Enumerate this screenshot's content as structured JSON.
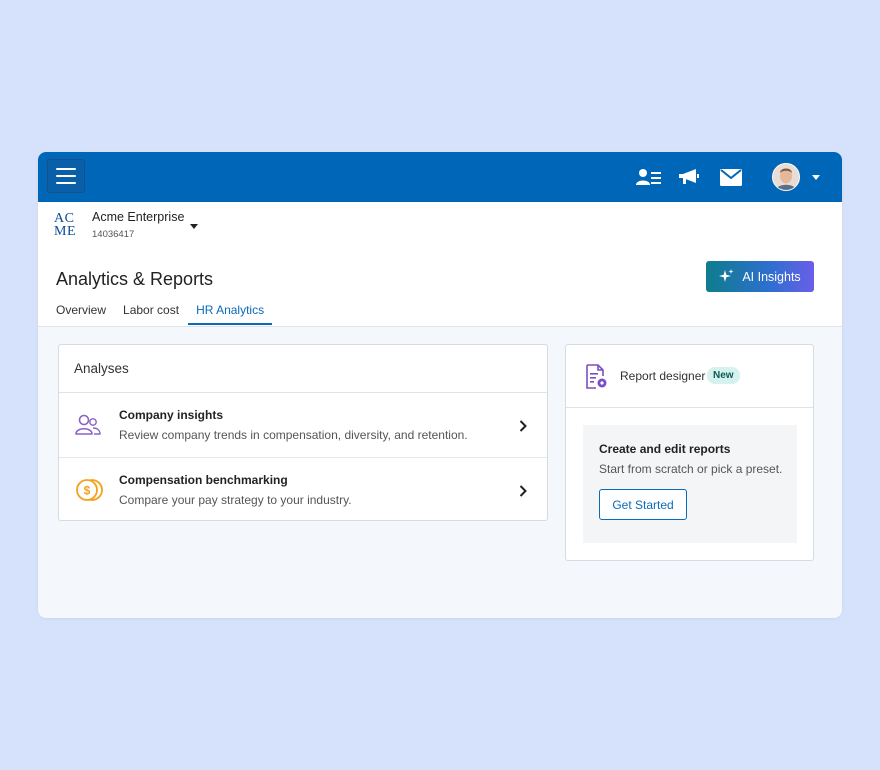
{
  "company": {
    "logo_top": "AC",
    "logo_bottom": "ME",
    "name": "Acme Enterprise",
    "id": "14036417"
  },
  "page": {
    "title": "Analytics & Reports",
    "ai_button": "AI Insights"
  },
  "tabs": [
    {
      "label": "Overview",
      "active": false
    },
    {
      "label": "Labor cost",
      "active": false
    },
    {
      "label": "HR Analytics",
      "active": true
    }
  ],
  "analyses": {
    "heading": "Analyses",
    "items": [
      {
        "title": "Company insights",
        "description": "Review company trends in compensation, diversity, and retention."
      },
      {
        "title": "Compensation benchmarking",
        "description": "Compare your pay strategy to your industry."
      }
    ]
  },
  "designer": {
    "label": "Report designer",
    "badge": "New",
    "create_title": "Create and edit reports",
    "create_description": "Start from scratch or pick a preset.",
    "button": "Get Started"
  },
  "colors": {
    "topbar": "#0067b8",
    "accent": "#0a6bb8",
    "background": "#d6e2fb"
  },
  "icons": [
    "menu-icon",
    "contacts-icon",
    "megaphone-icon",
    "mail-icon",
    "user-avatar",
    "sparkle-icon",
    "people-icon",
    "coins-icon",
    "chevron-right-icon",
    "report-settings-icon"
  ]
}
